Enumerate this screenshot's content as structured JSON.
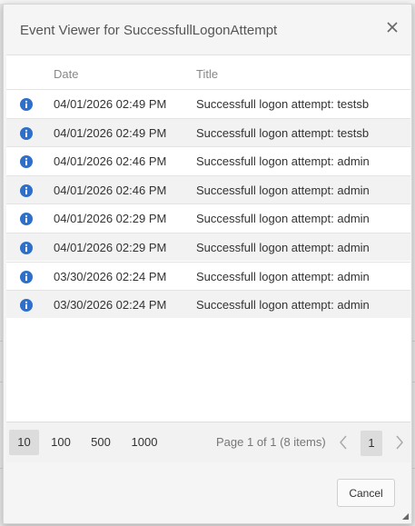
{
  "dialog": {
    "title": "Event Viewer for SuccessfullLogonAttempt"
  },
  "table": {
    "columns": {
      "date": "Date",
      "title": "Title"
    },
    "rows": [
      {
        "icon": "info-icon",
        "date": "04/01/2026 02:49 PM",
        "title": "Successfull logon attempt: testsb"
      },
      {
        "icon": "info-icon",
        "date": "04/01/2026 02:49 PM",
        "title": "Successfull logon attempt: testsb"
      },
      {
        "icon": "info-icon",
        "date": "04/01/2026 02:46 PM",
        "title": "Successfull logon attempt: admin"
      },
      {
        "icon": "info-icon",
        "date": "04/01/2026 02:46 PM",
        "title": "Successfull logon attempt: admin"
      },
      {
        "icon": "info-icon",
        "date": "04/01/2026 02:29 PM",
        "title": "Successfull logon attempt: admin"
      },
      {
        "icon": "info-icon",
        "date": "04/01/2026 02:29 PM",
        "title": "Successfull logon attempt: admin"
      },
      {
        "icon": "info-icon",
        "date": "03/30/2026 02:24 PM",
        "title": "Successfull logon attempt: admin"
      },
      {
        "icon": "info-icon",
        "date": "03/30/2026 02:24 PM",
        "title": "Successfull logon attempt: admin"
      }
    ]
  },
  "pager": {
    "page_sizes": [
      "10",
      "100",
      "500",
      "1000"
    ],
    "selected_page_size": "10",
    "page_info": "Page 1 of 1 (8 items)",
    "current_page": "1"
  },
  "footer": {
    "cancel_label": "Cancel"
  },
  "colors": {
    "info_icon": "#2d6fc9",
    "row_alt": "#f2f2f2"
  }
}
